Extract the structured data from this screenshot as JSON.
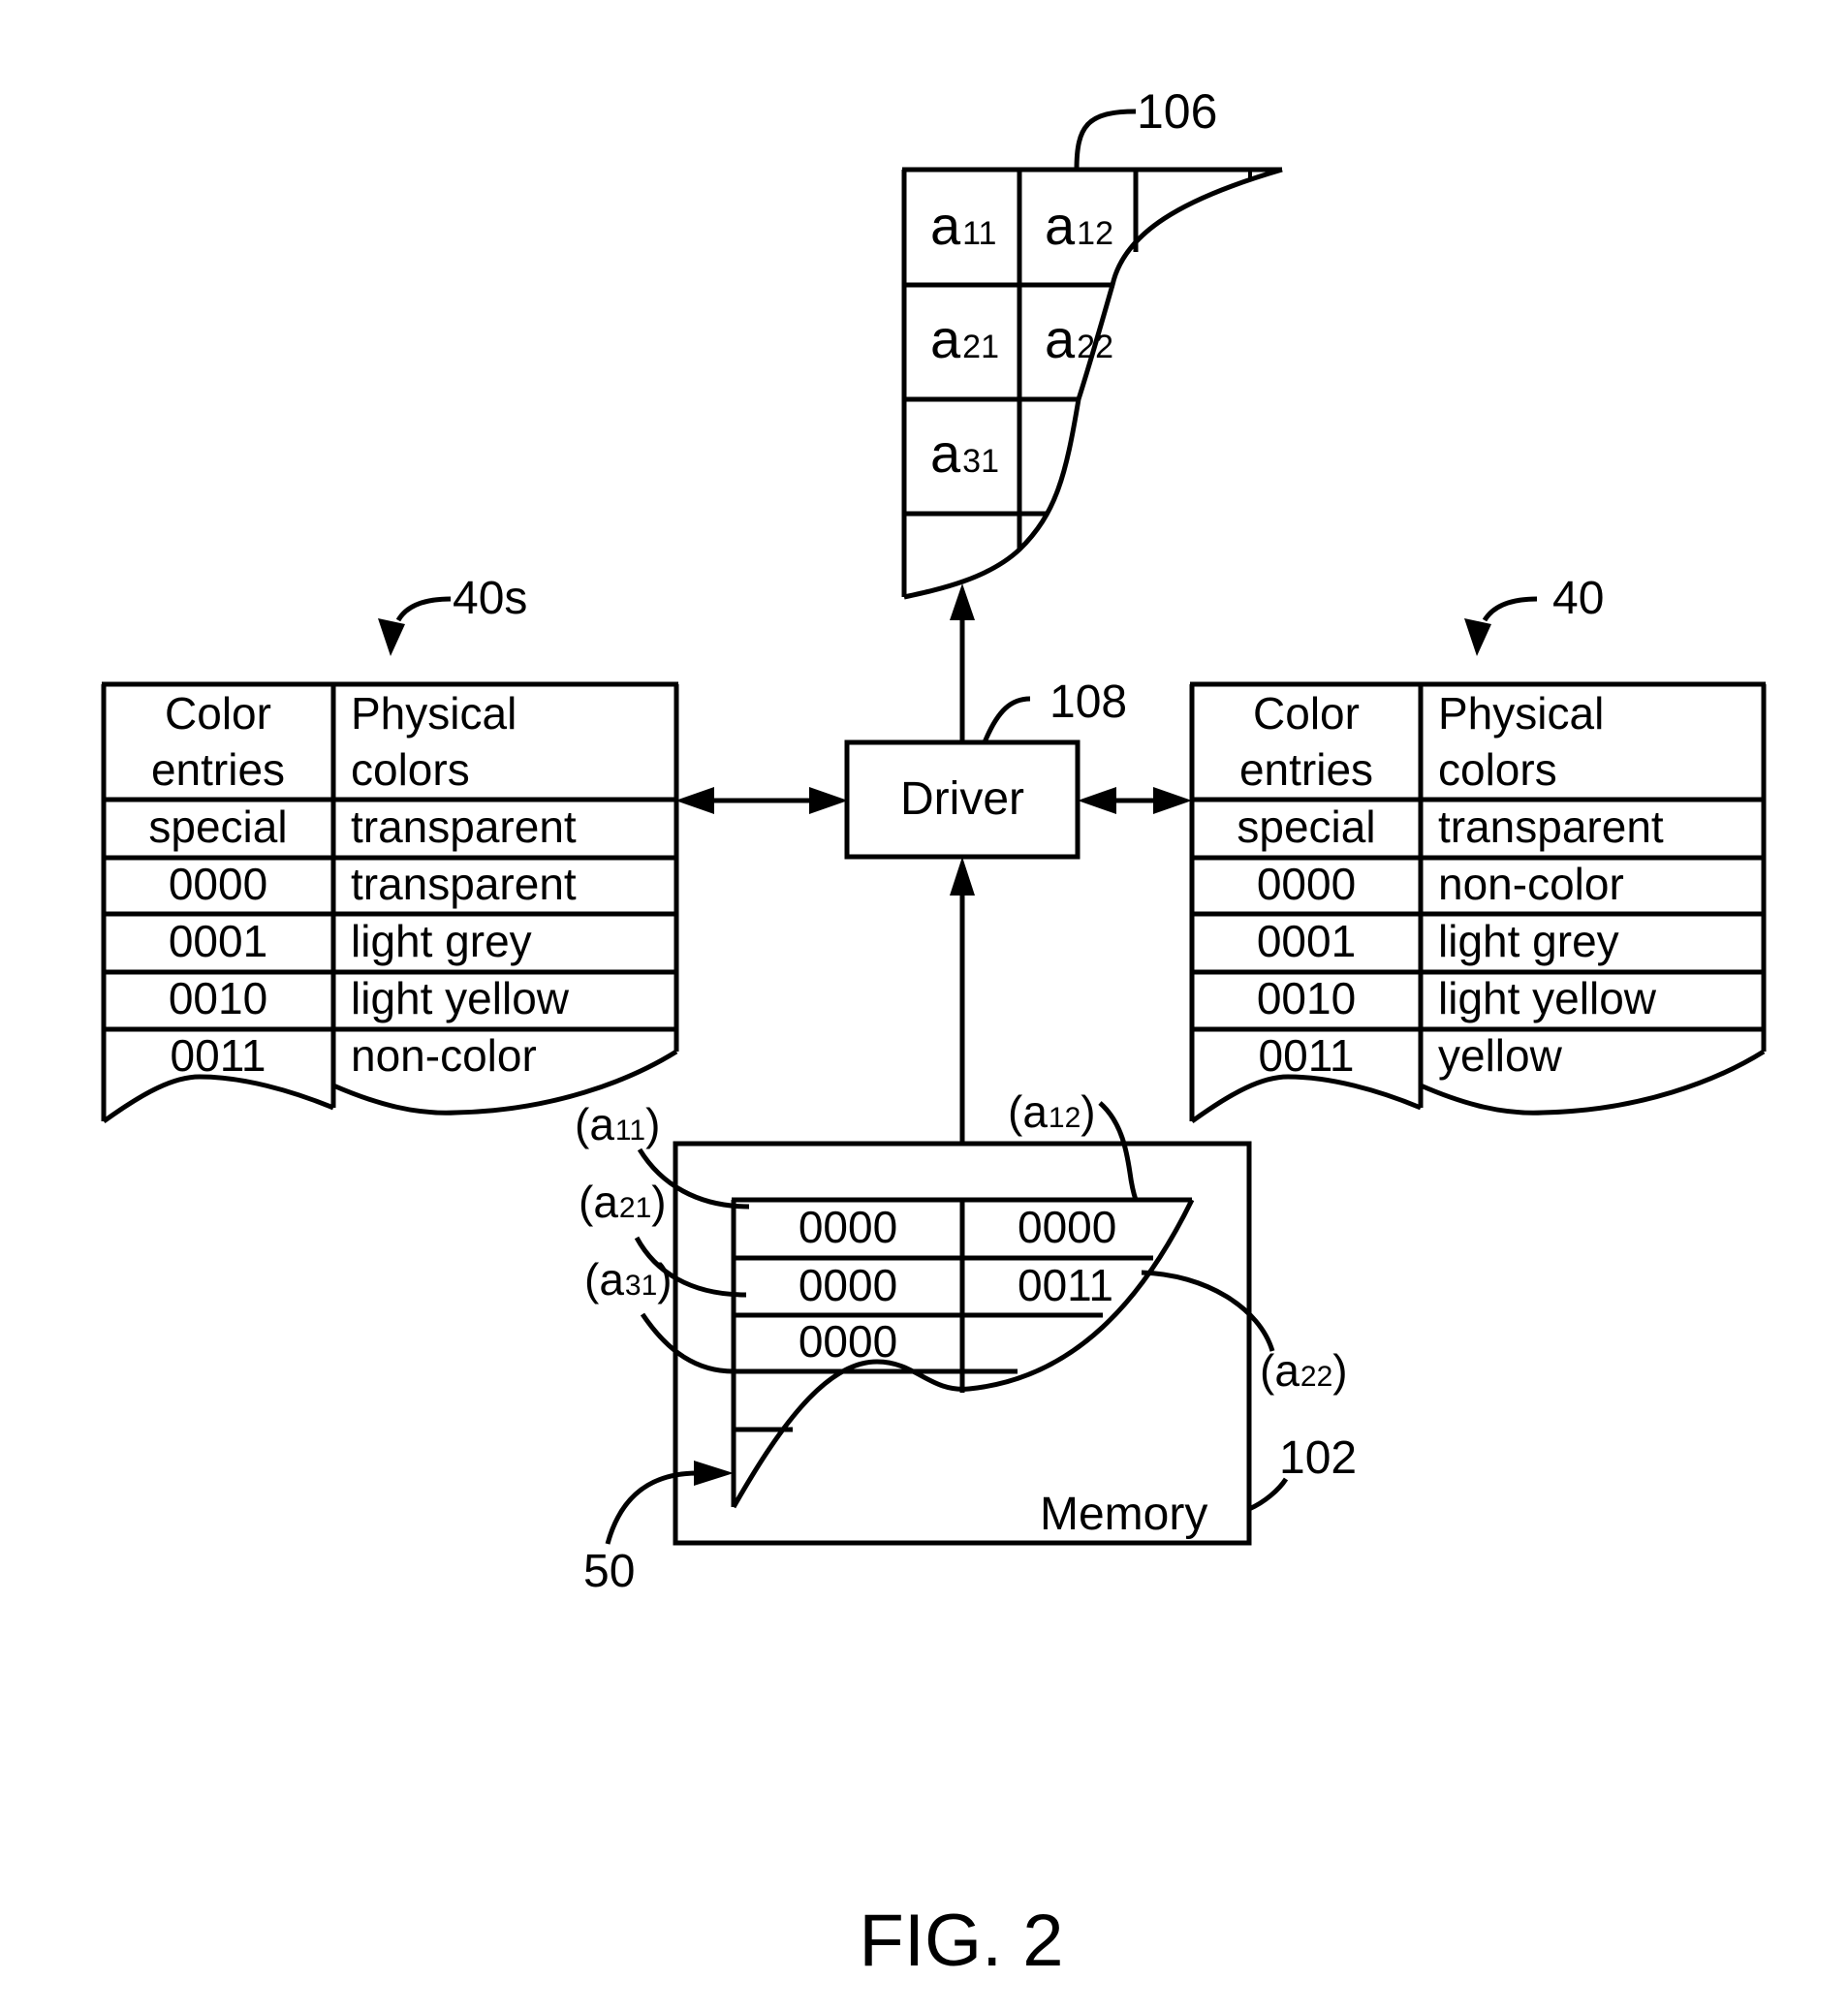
{
  "figure": {
    "caption": "FIG. 2",
    "ref_display_grid": "106",
    "ref_driver": "108",
    "ref_memory": "102",
    "ref_bitmap": "50",
    "ref_table_left": "40s",
    "ref_table_right": "40"
  },
  "display_grid": {
    "cells": [
      {
        "base": "a",
        "sub": "11"
      },
      {
        "base": "a",
        "sub": "12"
      },
      {
        "base": "a",
        "sub": "21"
      },
      {
        "base": "a",
        "sub": "22"
      },
      {
        "base": "a",
        "sub": "31"
      }
    ]
  },
  "driver": {
    "label": "Driver"
  },
  "memory": {
    "label": "Memory",
    "grid": [
      [
        "0000",
        "0000"
      ],
      [
        "0000",
        "0011"
      ],
      [
        "0000",
        ""
      ]
    ],
    "cell_labels": [
      {
        "open": "(a",
        "sub": "11",
        "close": ")"
      },
      {
        "open": "(a",
        "sub": "21",
        "close": ")"
      },
      {
        "open": "(a",
        "sub": "31",
        "close": ")"
      },
      {
        "open": "(a",
        "sub": "12",
        "close": ")"
      },
      {
        "open": "(a",
        "sub": "22",
        "close": ")"
      }
    ]
  },
  "table_left": {
    "header": {
      "col1_line1": "Color",
      "col1_line2": "entries",
      "col2_line1": "Physical",
      "col2_line2": "colors"
    },
    "rows": [
      [
        "special",
        "transparent"
      ],
      [
        "0000",
        "transparent"
      ],
      [
        "0001",
        "light grey"
      ],
      [
        "0010",
        "light yellow"
      ],
      [
        "0011",
        "non-color"
      ]
    ]
  },
  "table_right": {
    "header": {
      "col1_line1": "Color",
      "col1_line2": "entries",
      "col2_line1": "Physical",
      "col2_line2": "colors"
    },
    "rows": [
      [
        "special",
        "transparent"
      ],
      [
        "0000",
        "non-color"
      ],
      [
        "0001",
        "light grey"
      ],
      [
        "0010",
        "light yellow"
      ],
      [
        "0011",
        "yellow"
      ]
    ]
  }
}
